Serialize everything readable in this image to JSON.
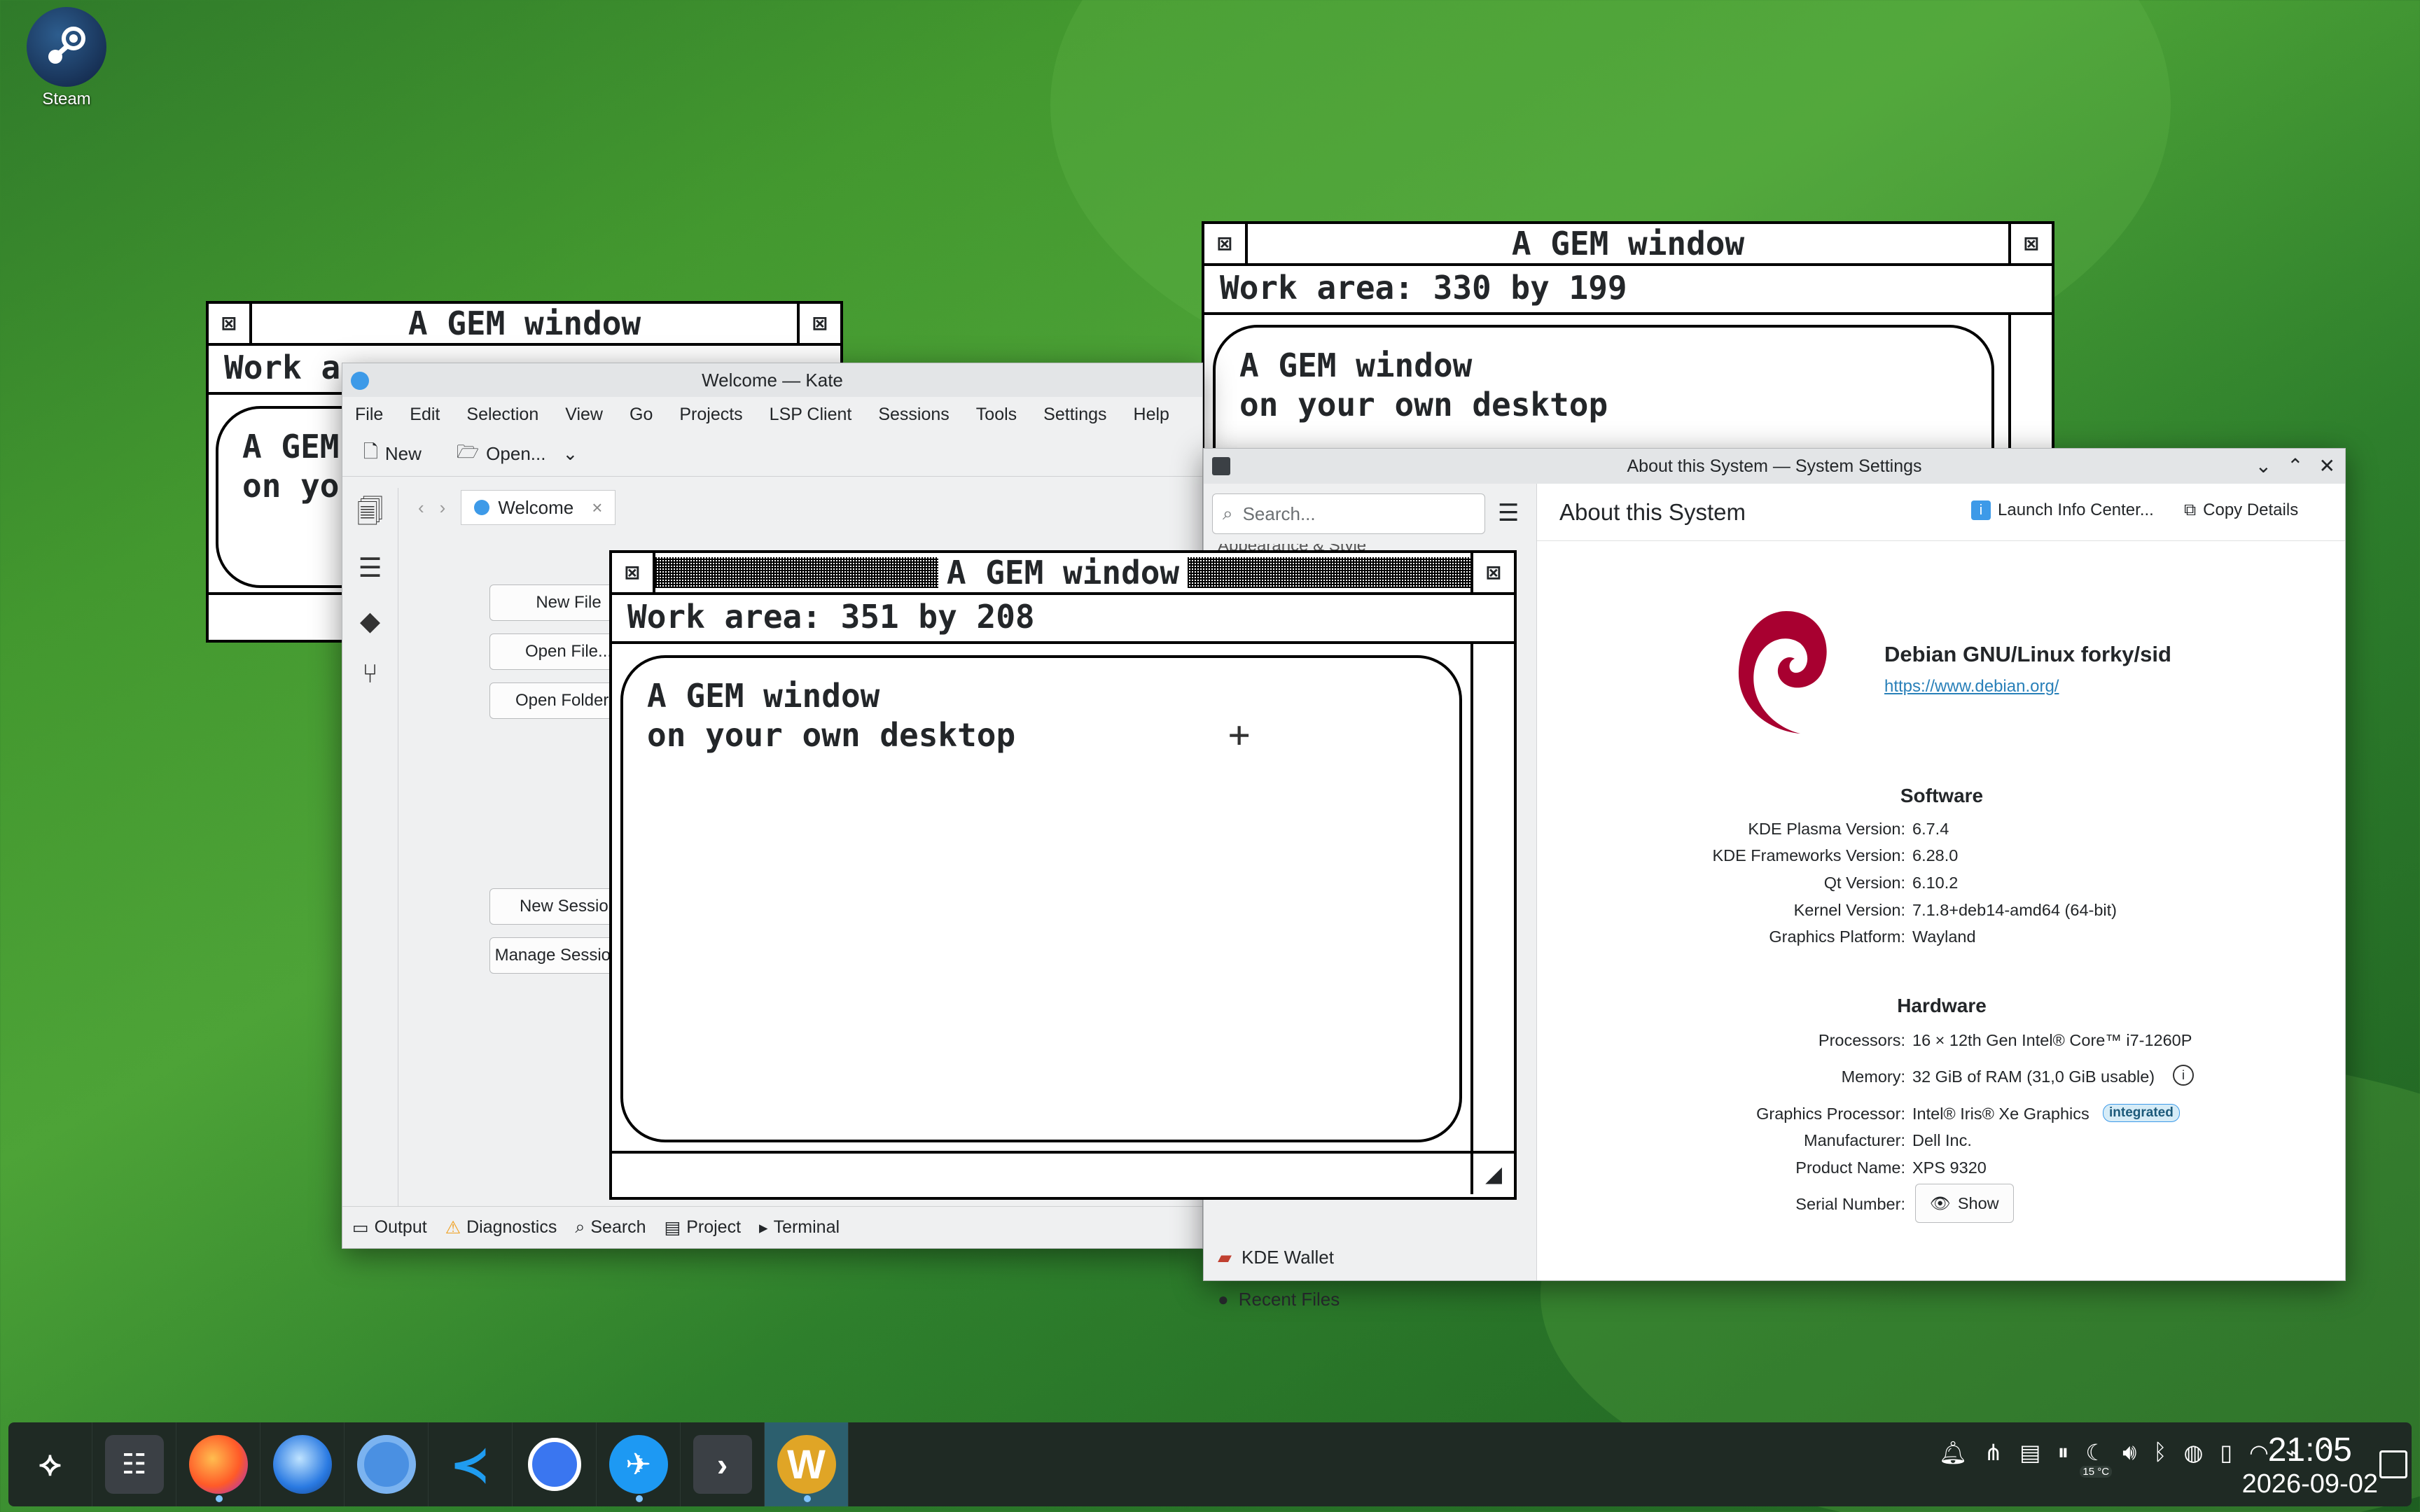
{
  "desktop": {
    "steam_label": "Steam"
  },
  "gem_back_left": {
    "title": "A GEM window",
    "info": "Work a",
    "body_line1": "A GEM",
    "body_line2": "on yo"
  },
  "gem_top_right": {
    "title": "A GEM window",
    "info": "Work area: 330 by 199",
    "body_line1": "A GEM window",
    "body_line2": "on your own desktop"
  },
  "gem_front": {
    "title": "A GEM window",
    "info": "Work area: 351 by 208",
    "body_line1": "A GEM window",
    "body_line2": "on your own desktop"
  },
  "kate": {
    "title": "Welcome — Kate",
    "menu": [
      "File",
      "Edit",
      "Selection",
      "View",
      "Go",
      "Projects",
      "LSP Client",
      "Sessions",
      "Tools",
      "Settings",
      "Help"
    ],
    "toolbar": {
      "new": "New",
      "open": "Open..."
    },
    "tab": "Welcome",
    "buttons": {
      "new_file": "New File",
      "open_file": "Open File...",
      "open_folder": "Open Folder...",
      "new_session": "New Session",
      "manage_sessions": "Manage Sessions..."
    },
    "status": [
      "Output",
      "Diagnostics",
      "Search",
      "Project",
      "Terminal"
    ]
  },
  "settings": {
    "title": "About this System — System Settings",
    "search_placeholder": "Search...",
    "header": "About this System",
    "launch_info": "Launch Info Center...",
    "copy_details": "Copy Details",
    "sidebar_partial_top": "Appearance & Style",
    "sidebar_kde_wallet": "KDE Wallet",
    "sidebar_recent_files": "Recent Files",
    "os_name": "Debian GNU/Linux forky/sid",
    "os_url": "https://www.debian.org/",
    "software_heading": "Software",
    "software": [
      {
        "k": "KDE Plasma Version:",
        "v": "6.7.4"
      },
      {
        "k": "KDE Frameworks Version:",
        "v": "6.28.0"
      },
      {
        "k": "Qt Version:",
        "v": "6.10.2"
      },
      {
        "k": "Kernel Version:",
        "v": "7.1.8+deb14-amd64 (64-bit)"
      },
      {
        "k": "Graphics Platform:",
        "v": "Wayland"
      }
    ],
    "hardware_heading": "Hardware",
    "hardware": [
      {
        "k": "Processors:",
        "v": "16 × 12th Gen Intel® Core™ i7-1260P"
      },
      {
        "k": "Memory:",
        "v": "32 GiB of RAM (31,0 GiB usable)"
      },
      {
        "k": "Graphics Processor:",
        "v": "Intel® Iris® Xe Graphics"
      },
      {
        "k": "Manufacturer:",
        "v": "Dell Inc."
      },
      {
        "k": "Product Name:",
        "v": "XPS 9320"
      },
      {
        "k": "Serial Number:",
        "v": ""
      }
    ],
    "gpu_badge": "integrated",
    "show_button": "Show"
  },
  "taskbar": {
    "apps": [
      "application-launcher-icon",
      "system-settings-icon",
      "firefox-icon",
      "thunderbird-icon",
      "chromium-icon",
      "vscode-icon",
      "signal-icon",
      "kate-icon",
      "terminal-icon",
      "gem-app-icon"
    ],
    "temperature": "15 °C",
    "time": "21:05",
    "date": "2026-09-02"
  }
}
